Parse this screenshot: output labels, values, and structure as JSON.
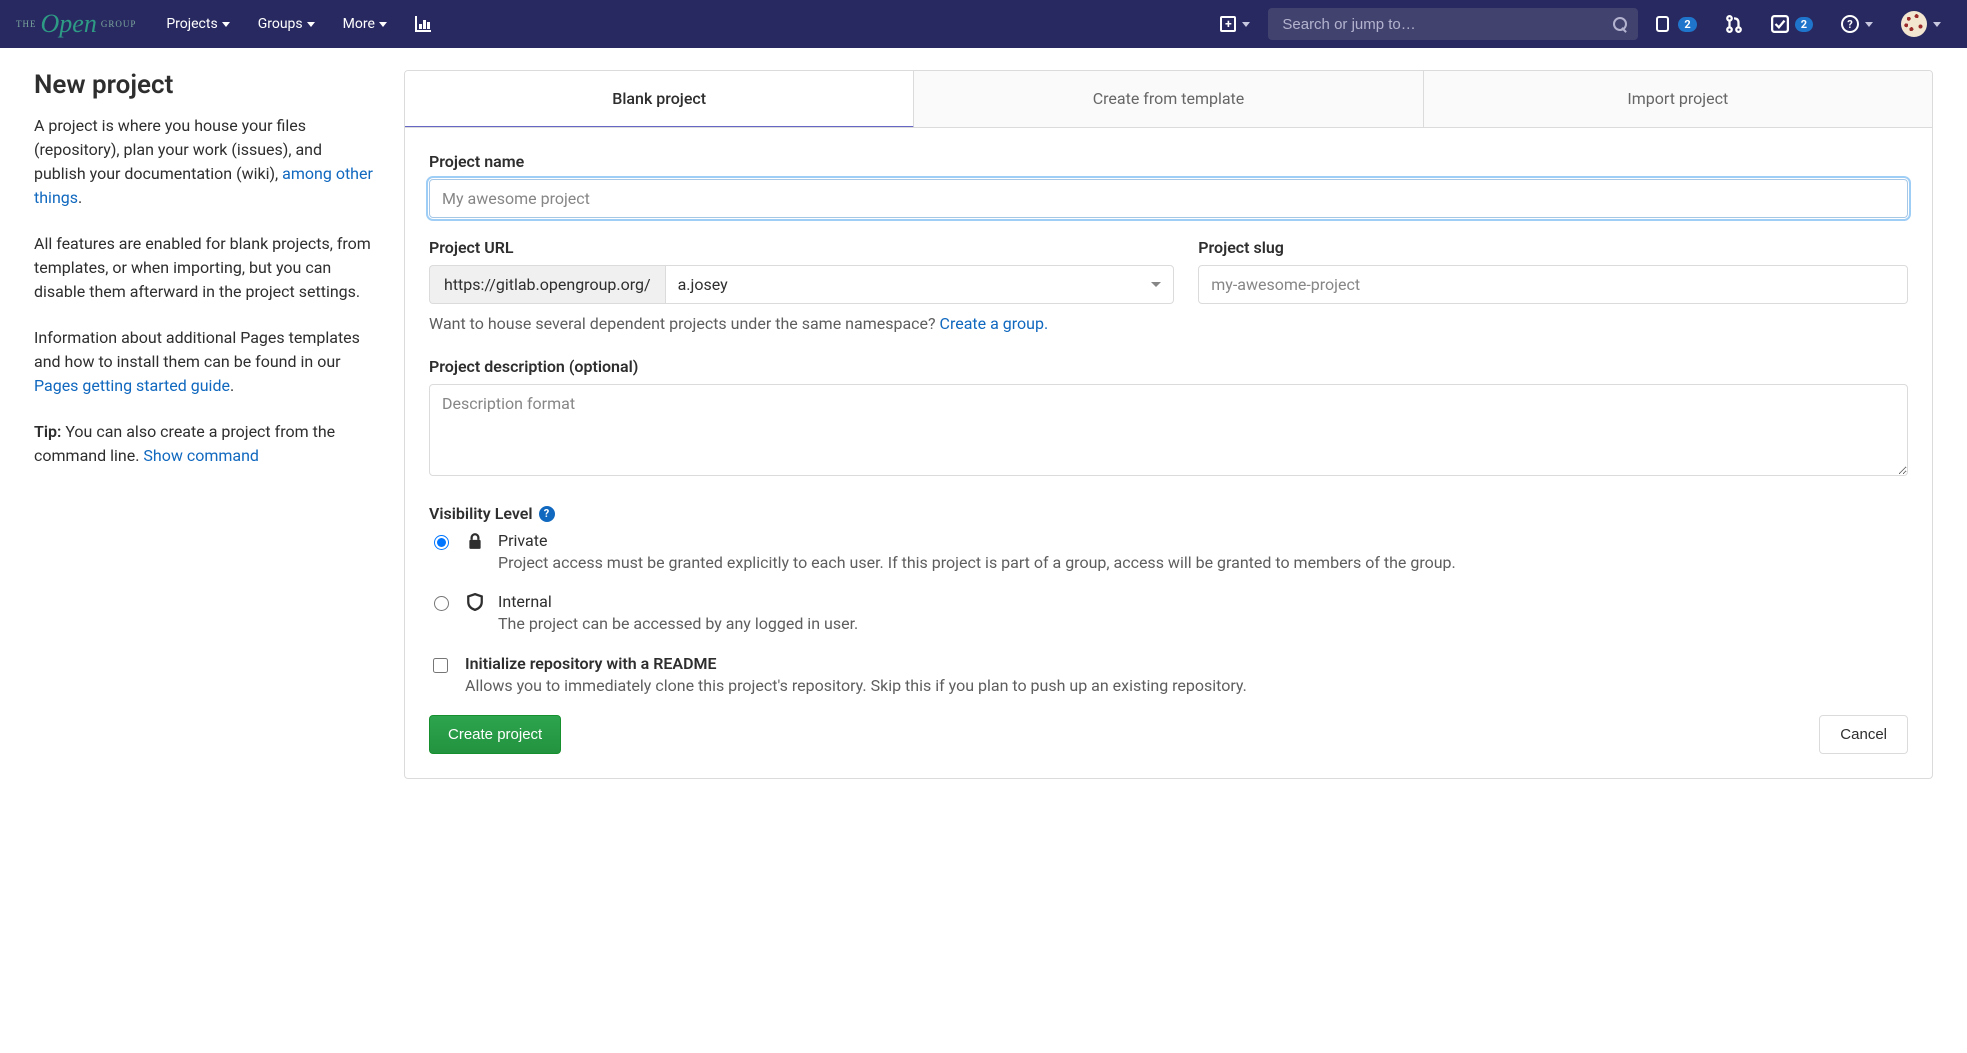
{
  "header": {
    "nav": {
      "projects": "Projects",
      "groups": "Groups",
      "more": "More"
    },
    "search_placeholder": "Search or jump to…",
    "badge_issues": "2",
    "badge_todos": "2"
  },
  "sidebar": {
    "title": "New project",
    "p1a": "A project is where you house your files (repository), plan your work (issues), and publish your documentation (wiki), ",
    "p1_link": "among other things",
    "p1b": ".",
    "p2": "All features are enabled for blank projects, from templates, or when importing, but you can disable them afterward in the project settings.",
    "p3a": "Information about additional Pages templates and how to install them can be found in our ",
    "p3_link": "Pages getting started guide",
    "p3b": ".",
    "tip_label": "Tip:",
    "tip_text": " You can also create a project from the command line. ",
    "tip_link": "Show command"
  },
  "tabs": {
    "blank": "Blank project",
    "template": "Create from template",
    "import": "Import project"
  },
  "form": {
    "name_label": "Project name",
    "name_placeholder": "My awesome project",
    "url_label": "Project URL",
    "url_prefix": "https://gitlab.opengroup.org/",
    "namespace": "a.josey",
    "slug_label": "Project slug",
    "slug_placeholder": "my-awesome-project",
    "group_hint": "Want to house several dependent projects under the same namespace? ",
    "group_link": "Create a group.",
    "desc_label": "Project description (optional)",
    "desc_placeholder": "Description format",
    "vis_label": "Visibility Level",
    "vis_private_title": "Private",
    "vis_private_desc": "Project access must be granted explicitly to each user. If this project is part of a group, access will be granted to members of the group.",
    "vis_internal_title": "Internal",
    "vis_internal_desc": "The project can be accessed by any logged in user.",
    "readme_title": "Initialize repository with a README",
    "readme_desc": "Allows you to immediately clone this project's repository. Skip this if you plan to push up an existing repository.",
    "create_btn": "Create project",
    "cancel_btn": "Cancel"
  }
}
